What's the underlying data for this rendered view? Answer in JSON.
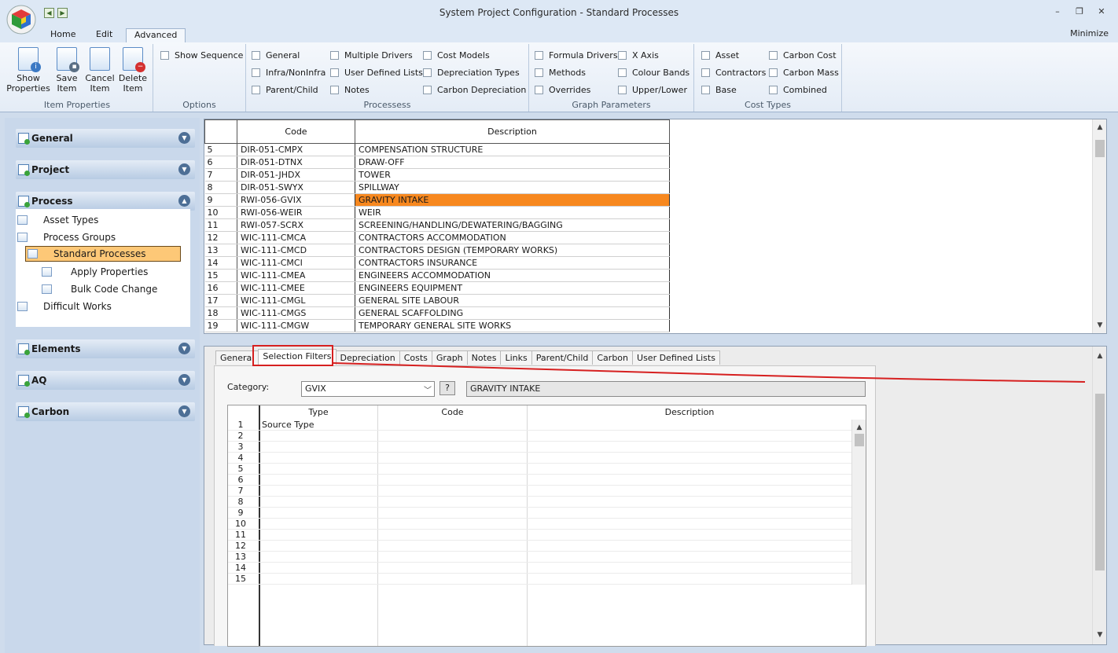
{
  "window": {
    "title": "System Project Configuration - Standard Processes",
    "minimize_label": "Minimize"
  },
  "ribbon": {
    "tabs": [
      "Home",
      "Edit",
      "Advanced"
    ],
    "active_tab": "Advanced",
    "item_properties": {
      "group_label": "Item Properties",
      "show_properties": "Show Properties",
      "save_item": "Save Item",
      "cancel_item": "Cancel Item",
      "delete_item": "Delete Item"
    },
    "options": {
      "group_label": "Options",
      "show_sequence": "Show Sequence"
    },
    "processes": {
      "group_label": "Processess",
      "items": [
        "General",
        "Infra/NonInfra",
        "Parent/Child",
        "Multiple Drivers",
        "User Defined Lists",
        "Notes",
        "Cost Models",
        "Depreciation Types",
        "Carbon Depreciation"
      ]
    },
    "graph_parameters": {
      "group_label": "Graph Parameters",
      "items": [
        "Formula Drivers",
        "Methods",
        "Overrides",
        "X Axis",
        "Colour Bands",
        "Upper/Lower"
      ]
    },
    "cost_types": {
      "group_label": "Cost Types",
      "items": [
        "Asset",
        "Contractors",
        "Base",
        "Carbon Cost",
        "Carbon Mass",
        "Combined"
      ]
    }
  },
  "nav": {
    "sections": [
      "General",
      "Project",
      "Process",
      "Elements",
      "AQ",
      "Carbon"
    ],
    "process_items": [
      "Asset Types",
      "Process Groups",
      "Standard Processes",
      "Apply Properties",
      "Bulk Code Change",
      "Difficult Works"
    ],
    "selected": "Standard Processes"
  },
  "process_grid": {
    "headers": {
      "code": "Code",
      "description": "Description"
    },
    "rows": [
      {
        "n": "5",
        "code": "DIR-051-CMPX",
        "desc": "COMPENSATION STRUCTURE"
      },
      {
        "n": "6",
        "code": "DIR-051-DTNX",
        "desc": "DRAW-OFF"
      },
      {
        "n": "7",
        "code": "DIR-051-JHDX",
        "desc": "TOWER"
      },
      {
        "n": "8",
        "code": "DIR-051-SWYX",
        "desc": "SPILLWAY"
      },
      {
        "n": "9",
        "code": "RWI-056-GVIX",
        "desc": "GRAVITY INTAKE"
      },
      {
        "n": "10",
        "code": "RWI-056-WEIR",
        "desc": "WEIR"
      },
      {
        "n": "11",
        "code": "RWI-057-SCRX",
        "desc": "SCREENING/HANDLING/DEWATERING/BAGGING"
      },
      {
        "n": "12",
        "code": "WIC-111-CMCA",
        "desc": "CONTRACTORS ACCOMMODATION"
      },
      {
        "n": "13",
        "code": "WIC-111-CMCD",
        "desc": "CONTRACTORS DESIGN (TEMPORARY WORKS)"
      },
      {
        "n": "14",
        "code": "WIC-111-CMCI",
        "desc": "CONTRACTORS INSURANCE"
      },
      {
        "n": "15",
        "code": "WIC-111-CMEA",
        "desc": "ENGINEERS ACCOMMODATION"
      },
      {
        "n": "16",
        "code": "WIC-111-CMEE",
        "desc": "ENGINEERS EQUIPMENT"
      },
      {
        "n": "17",
        "code": "WIC-111-CMGL",
        "desc": "GENERAL SITE LABOUR"
      },
      {
        "n": "18",
        "code": "WIC-111-CMGS",
        "desc": "GENERAL SCAFFOLDING"
      },
      {
        "n": "19",
        "code": "WIC-111-CMGW",
        "desc": "TEMPORARY GENERAL SITE WORKS"
      }
    ],
    "selected_row": "9"
  },
  "details": {
    "tabs": [
      "General",
      "Selection Filters",
      "Depreciation",
      "Costs",
      "Graph",
      "Notes",
      "Links",
      "Parent/Child",
      "Carbon",
      "User Defined Lists"
    ],
    "active_tab": "Selection Filters",
    "category_label": "Category:",
    "category_value": "GVIX",
    "help_label": "?",
    "category_description": "GRAVITY INTAKE",
    "filter_headers": {
      "type": "Type",
      "code": "Code",
      "description": "Description"
    },
    "filter_rows": [
      {
        "n": "1",
        "type": "Source Type"
      },
      {
        "n": "2",
        "type": ""
      },
      {
        "n": "3",
        "type": ""
      },
      {
        "n": "4",
        "type": ""
      },
      {
        "n": "5",
        "type": ""
      },
      {
        "n": "6",
        "type": ""
      },
      {
        "n": "7",
        "type": ""
      },
      {
        "n": "8",
        "type": ""
      },
      {
        "n": "9",
        "type": ""
      },
      {
        "n": "10",
        "type": ""
      },
      {
        "n": "11",
        "type": ""
      },
      {
        "n": "12",
        "type": ""
      },
      {
        "n": "13",
        "type": ""
      },
      {
        "n": "14",
        "type": ""
      },
      {
        "n": "15",
        "type": ""
      }
    ]
  },
  "colors": {
    "highlight": "#f7881f",
    "nav_selected": "#fdc877",
    "annotation": "#d62020"
  }
}
